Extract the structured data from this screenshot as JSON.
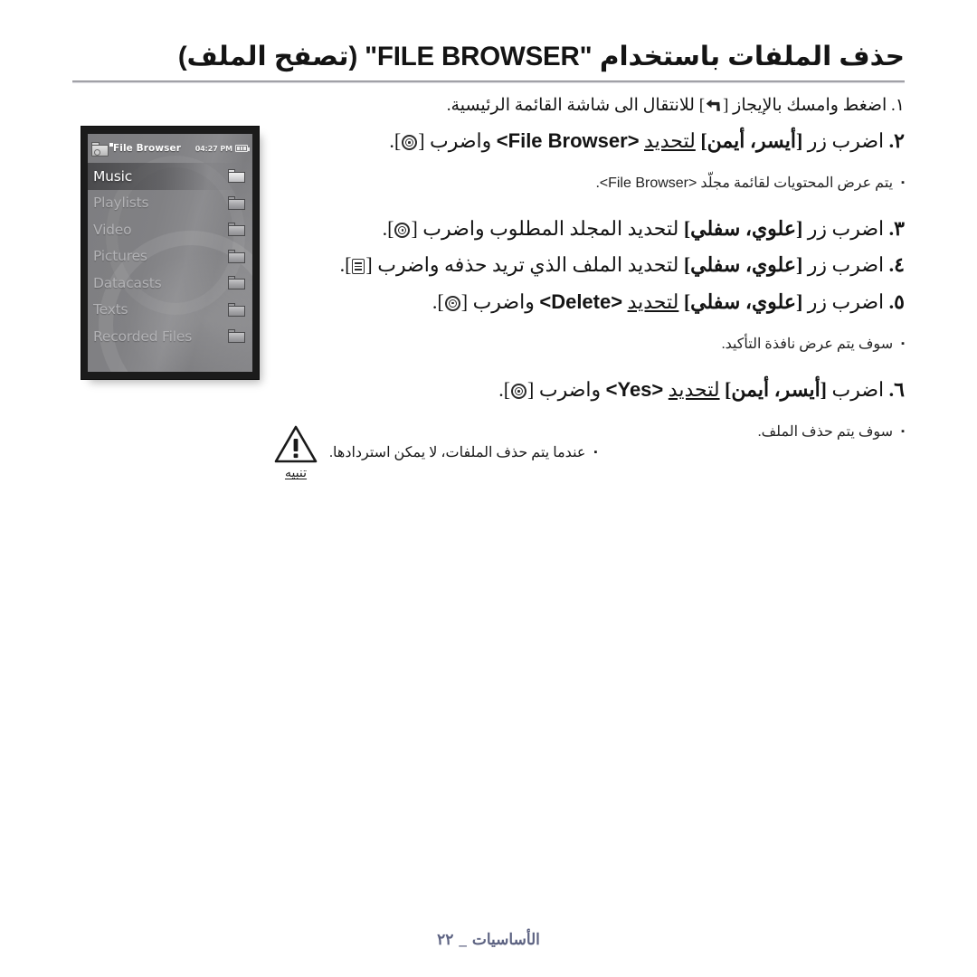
{
  "page": {
    "title": "حذف الملفات باستخدام \"FILE BROWSER\" (تصفح الملف)",
    "language": "Arabic",
    "footer_page_number": "٢٢",
    "footer_separator": "_",
    "footer_section": "الأساسيات",
    "footer_color": "#5d6382"
  },
  "device": {
    "header": {
      "icon": "folder-camera-icon",
      "title": "File Browser",
      "time": "04:27 PM",
      "battery_icon": "battery-full-icon"
    },
    "list": [
      {
        "label": "Music",
        "icon": "folder-icon",
        "selected": true
      },
      {
        "label": "Playlists",
        "icon": "folder-icon",
        "selected": false
      },
      {
        "label": "Video",
        "icon": "folder-icon",
        "selected": false
      },
      {
        "label": "Pictures",
        "icon": "folder-icon",
        "selected": false
      },
      {
        "label": "Datacasts",
        "icon": "folder-icon",
        "selected": false
      },
      {
        "label": "Texts",
        "icon": "folder-icon",
        "selected": false
      },
      {
        "label": "Recorded Files",
        "icon": "folder-icon",
        "selected": false
      }
    ]
  },
  "steps": {
    "step1": {
      "number": "١.",
      "text_before_key": "اضغط وامسك بالإيجاز",
      "key_icon": "back-arrow-icon",
      "text_after_key": "للانتقال الى شاشة القائمة الرئيسية."
    },
    "step2": {
      "number": "٢.",
      "lead": "اضرب زر",
      "button_label": "[أيسر، أيمن]",
      "select_word": "لتحديد",
      "tag": "<File Browser>",
      "and_press": "واضرب",
      "key_icon": "select-circle-icon",
      "tail": "."
    },
    "note2": {
      "bullet": "▪",
      "text_before_tag": "يتم عرض المحتويات لقائمة مجلّد",
      "tag": "<File Browser>",
      "tail": "."
    },
    "step3": {
      "number": "٣.",
      "lead": "اضرب زر",
      "button_label": "[علوي، سفلي]",
      "body": "لتحديد المجلد المطلوب واضرب",
      "key_icon": "select-circle-icon",
      "tail": "."
    },
    "step4": {
      "number": "٤.",
      "lead": "اضرب زر",
      "button_label": "[علوي، سفلي]",
      "body": "لتحديد الملف الذي تريد حذفه واضرب",
      "key_icon": "menu-list-icon",
      "tail": "."
    },
    "step5": {
      "number": "٥.",
      "lead": "اضرب زر",
      "button_label": "[علوي، سفلي]",
      "select_word": "لتحديد",
      "tag": "<Delete>",
      "and_press": "واضرب",
      "key_icon": "select-circle-icon",
      "tail": "."
    },
    "note5": {
      "bullet": "▪",
      "text": "سوف يتم عرض نافذة التأكيد."
    },
    "step6": {
      "number": "٦.",
      "lead": "اضرب",
      "button_label": "[أيسر، أيمن]",
      "select_word": "لتحديد",
      "tag": "<Yes>",
      "and_press": "واضرب",
      "key_icon": "select-circle-icon",
      "tail": "."
    },
    "note6": {
      "bullet": "▪",
      "text": "سوف يتم حذف الملف."
    }
  },
  "caution": {
    "icon": "warning-triangle-icon",
    "label": "تنبيه",
    "bullet": "▪",
    "text": "عندما يتم حذف الملفات، لا يمكن استردادها."
  }
}
